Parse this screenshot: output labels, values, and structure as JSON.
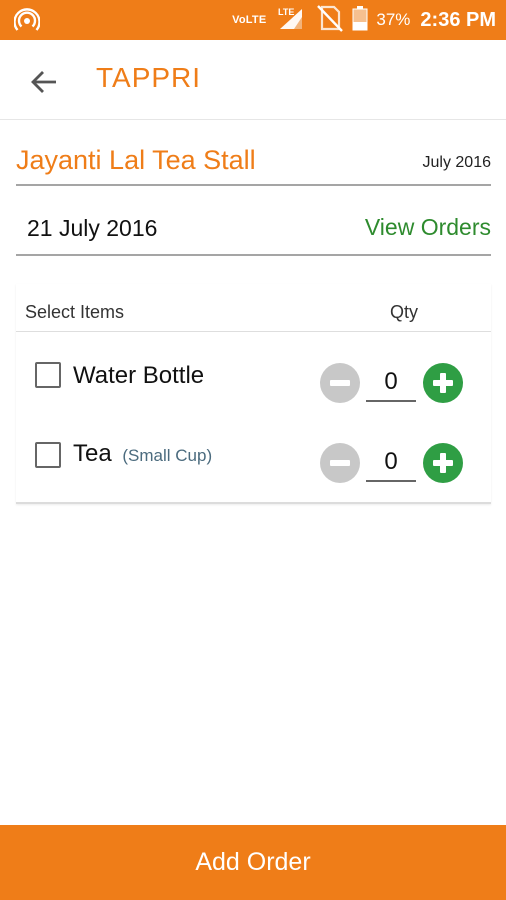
{
  "status_bar": {
    "volte": "VoLTE",
    "lte": "LTE",
    "battery": "37%",
    "time": "2:36 PM",
    "icons": [
      "hotspot-icon",
      "signal-icon",
      "no-sim-icon",
      "battery-icon"
    ]
  },
  "app_bar": {
    "title": "TAPPRI",
    "back_icon": "arrow-back-icon"
  },
  "stall": {
    "name": "Jayanti Lal Tea Stall",
    "month": "July 2016"
  },
  "date_row": {
    "date": "21 July 2016",
    "view_orders": "View Orders"
  },
  "items_table": {
    "header_items": "Select Items",
    "header_qty": "Qty",
    "items": [
      {
        "name": "Water Bottle",
        "sub": "",
        "qty": "0",
        "checked": false
      },
      {
        "name": "Tea",
        "sub": "(Small Cup)",
        "qty": "0",
        "checked": false
      }
    ]
  },
  "footer": {
    "add_order": "Add Order"
  },
  "colors": {
    "accent": "#ef7d18",
    "green": "#2e8b2e",
    "plus_green": "#2f9e44",
    "minus_gray": "#c8c8c8"
  }
}
